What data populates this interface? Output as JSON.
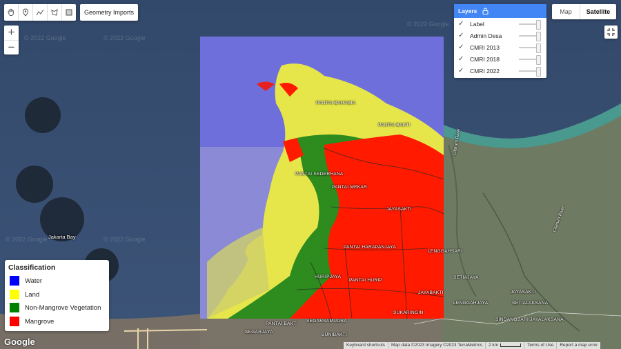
{
  "toolbar": {
    "tools": [
      {
        "icon": "hand-icon"
      },
      {
        "icon": "marker-icon"
      },
      {
        "icon": "polyline-icon"
      },
      {
        "icon": "polygon-icon"
      },
      {
        "icon": "rectangle-icon"
      }
    ],
    "geometry_imports_label": "Geometry Imports"
  },
  "zoom": {
    "in_label": "+",
    "out_label": "−"
  },
  "map_type": {
    "map_label": "Map",
    "satellite_label": "Satellite",
    "selected": "Satellite"
  },
  "layers": {
    "title": "Layers",
    "items": [
      {
        "label": "Label",
        "checked": true
      },
      {
        "label": "Admin Desa",
        "checked": true
      },
      {
        "label": "CMRI 2013",
        "checked": true
      },
      {
        "label": "CMRI 2018",
        "checked": true
      },
      {
        "label": "CMRI 2022",
        "checked": true
      }
    ]
  },
  "legend": {
    "title": "Classification",
    "items": [
      {
        "label": "Water",
        "color": "#0000ff"
      },
      {
        "label": "Land",
        "color": "#ffff00"
      },
      {
        "label": "Non-Mangrove Vegetation",
        "color": "#008000"
      },
      {
        "label": "Mangrove",
        "color": "#ff0000"
      }
    ]
  },
  "map_labels": {
    "pantai_bahagia": "PANTAI BAHAGIA",
    "pantai_bakti": "PANTAI BAKTI",
    "pantai_sederhana": "PANTAI SEDERHANA",
    "pantai_mekar": "PANTAI MEKAR",
    "jayasakti": "JAYASAKTI",
    "pantai_harapanjaya": "PANTAI HARAPANJAYA",
    "lenggahsari": "LENGGAHSARI",
    "huripjaya": "HURIPJAYA",
    "pantai_hurip": "PANTAI HURIP",
    "setiajaya": "SETIAJAYA",
    "jayabakti": "JAYABAKTI",
    "lenggahjaya": "LENGGAHJAYA",
    "jayasakti2": "JAYASAKTI",
    "setialaksana": "SETIALAKSANA",
    "sukaringin": "SUKARINGIN",
    "sindangsari": "SINDANGSARI JAYALAKSANA",
    "pantai_bakti2": "PANTAI BAKTI",
    "segarsamudra": "SEGARSAMUDRA",
    "segarjaya": "SEGARJAYA",
    "bunibakti": "BUNIBAKTI",
    "jakarta_bay": "Jakarta Bay",
    "citarum_river": "Citarum River",
    "cibarusah_river": "Citarum River"
  },
  "watermark": "© 2022 Google",
  "footer": {
    "logo": "Google",
    "keyboard_shortcuts": "Keyboard shortcuts",
    "map_data": "Map data ©2023 Imagery ©2023 TerraMetrics",
    "scale": "2 km",
    "terms": "Terms of Use",
    "report": "Report a map error"
  }
}
